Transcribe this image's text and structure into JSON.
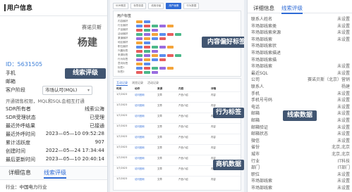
{
  "left": {
    "header": "用户信息",
    "company": "赛诺贝斯",
    "contact_name": "杨建",
    "id_line": "ID：5631505",
    "fields": [
      {
        "label": "手机",
        "value": ""
      },
      {
        "label": "邮箱",
        "value": ""
      },
      {
        "label": "客户阶段",
        "value": ""
      }
    ],
    "stage_select": "市场认可(MQL)",
    "note": "开通销售权限，MQL和SQL会相互打通",
    "stats": [
      {
        "label": "SDR所有者",
        "value": "线索公海"
      },
      {
        "label": "SDR受理状态",
        "value": "已受理"
      },
      {
        "label": "最近外呼结果",
        "value": "已接通"
      },
      {
        "label": "最近外呼时间",
        "value": "2023—05—10 09:52:28"
      },
      {
        "label": "累计活跃度",
        "value": "907"
      },
      {
        "label": "创建时间",
        "value": "2022—05—24 17:34:44"
      },
      {
        "label": "最后更新时间",
        "value": "2023—05—10 20:40:14"
      }
    ],
    "tabs": [
      "详细信息",
      "线索评级"
    ],
    "footer_label": "行业：",
    "footer_value": "中国电力行业"
  },
  "mid": {
    "top_tabs": [
      "SDR概览",
      "标签信息",
      "线索评级",
      "用户画像",
      "行为数据"
    ],
    "active_tab_index": 3,
    "card_title": "用户标签",
    "tag_rows": [
      "内容偏好",
      "行业偏好",
      "产品偏好",
      "活动偏好",
      "渠道偏好",
      "地区偏好",
      "职位偏好",
      "兴趣标签",
      "来源标签",
      "行为标签",
      "意向标签",
      "标签1",
      "标签2"
    ],
    "table_tabs": [
      "互动记录",
      "浏览记录",
      "活动记录"
    ],
    "table_headers": [
      "时间",
      "动作",
      "来源",
      "内容",
      "详情"
    ],
    "table_rows": [
      [
        "1/7/2023",
        "访问官网",
        "文章",
        "产品介绍",
        "内容"
      ],
      [
        "1/7/2023",
        "访问官网",
        "文章",
        "产品介绍",
        "内容"
      ],
      [
        "1/7/2023",
        "访问官网",
        "文章",
        "产品介绍",
        "内容"
      ],
      [
        "1/7/2023",
        "访问官网",
        "文章",
        "产品介绍",
        "内容"
      ],
      [
        "1/7/2023",
        "访问官网",
        "文章",
        "产品介绍",
        "内容"
      ],
      [
        "1/7/2023",
        "访问官网",
        "文章",
        "产品介绍",
        "内容"
      ],
      [
        "1/7/2023",
        "访问官网",
        "文章",
        "产品介绍",
        "内容"
      ],
      [
        "1/7/2023",
        "访问官网",
        "文章",
        "产品介绍",
        "内容"
      ],
      [
        "1/7/2023",
        "访问官网",
        "文章",
        "产品介绍",
        "内容"
      ]
    ]
  },
  "right": {
    "tabs": [
      "详细信息",
      "线索评级"
    ],
    "rows": [
      {
        "label": "联系人姓名",
        "value": "未设置"
      },
      {
        "label": "市场部线索类",
        "value": "未设置"
      },
      {
        "label": "市场部线索来源",
        "value": "未设置"
      },
      {
        "label": "市场部线索",
        "value": "未设置"
      },
      {
        "label": "市场部线索状",
        "value": ""
      },
      {
        "label": "市场部线索描述",
        "value": ""
      },
      {
        "label": "市场部线索描",
        "value": ""
      },
      {
        "label": "市场部线索",
        "value": "未设置"
      },
      {
        "label": "最近SQL",
        "value": "未设置"
      },
      {
        "label": "公司",
        "value": "赛诺贝斯（北京）营销"
      },
      {
        "label": "联系人",
        "value": "杨建"
      },
      {
        "label": "手机",
        "value": "未设置"
      },
      {
        "label": "手机号号码",
        "value": "未设置"
      },
      {
        "label": "电话",
        "value": "未设置"
      },
      {
        "label": "邮箱",
        "value": "未设置"
      },
      {
        "label": "邮箱",
        "value": "未设置"
      },
      {
        "label": "邮箱验证",
        "value": "未设置"
      },
      {
        "label": "邮箱状态",
        "value": "未设置"
      },
      {
        "label": "微信",
        "value": "未设置"
      },
      {
        "label": "省份",
        "value": "北京,北京"
      },
      {
        "label": "城市",
        "value": "北京,北京"
      },
      {
        "label": "行业",
        "value": "IT科技"
      },
      {
        "label": "部门",
        "value": "IT部门"
      },
      {
        "label": "职位",
        "value": "未设置"
      },
      {
        "label": "市场部线索",
        "value": "未设置"
      },
      {
        "label": "市场部线索",
        "value": "未设置"
      }
    ]
  },
  "overlays": {
    "left": "线索评级",
    "mid_top": "内容偏好标签",
    "mid_mid": "行为标签",
    "mid_bottom": "商机数据",
    "right": "线索数据"
  }
}
